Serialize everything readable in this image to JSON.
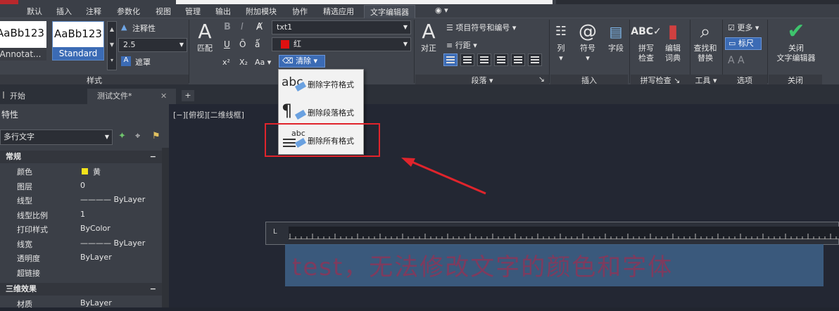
{
  "ribbon_tabs": [
    "默认",
    "插入",
    "注释",
    "参数化",
    "视图",
    "管理",
    "输出",
    "附加模块",
    "协作",
    "精选应用",
    "文字编辑器"
  ],
  "style_panel": {
    "samples": [
      {
        "preview": "AaBb123",
        "name": "Annotat..."
      },
      {
        "preview": "AaBb123",
        "name": "Standard"
      }
    ],
    "annotative": "注释性",
    "height": "2.5",
    "mask": "遮罩",
    "match": "匹配",
    "title": "样式"
  },
  "format_panel": {
    "font": "txt1",
    "color": "红",
    "color_hex": "#e01010",
    "clear": "清除",
    "bold": "B",
    "italic": "I",
    "underline": "U",
    "overline": "Ō",
    "sup": "x²",
    "sub": "X₂",
    "case": "Aa"
  },
  "paragraph_panel": {
    "align": "对正",
    "bullets": "项目符号和编号",
    "spacing": "行距",
    "title": "段落"
  },
  "insert_panel": {
    "columns": "列",
    "symbol": "符号",
    "field": "字段",
    "title": "插入"
  },
  "spell_panel": {
    "check": "拼写\n检查",
    "dict": "编辑\n词典",
    "title": "拼写检查"
  },
  "tools_panel": {
    "find": "查找和\n替换",
    "title": "工具"
  },
  "options_panel": {
    "more": "更多",
    "ruler": "标尺",
    "title": "选项"
  },
  "close_panel": {
    "close": "关闭\n文字编辑器",
    "title": "关闭"
  },
  "doc_tabs": [
    "开始",
    "测试文件*"
  ],
  "properties": {
    "title": "特性",
    "selection": "多行文字",
    "sections": {
      "general": "常规",
      "3d": "三维效果"
    },
    "rows": [
      {
        "k": "颜色",
        "v": "黄"
      },
      {
        "k": "图层",
        "v": "0"
      },
      {
        "k": "线型",
        "v": "———— ByLayer"
      },
      {
        "k": "线型比例",
        "v": "1"
      },
      {
        "k": "打印样式",
        "v": "ByColor"
      },
      {
        "k": "线宽",
        "v": "———— ByLayer"
      },
      {
        "k": "透明度",
        "v": "ByLayer"
      },
      {
        "k": "超链接",
        "v": ""
      }
    ],
    "material": {
      "k": "材质",
      "v": "ByLayer"
    }
  },
  "view_label": "[−][俯视][二维线框]",
  "edit_text": "test，无法修改文字的颜色和字体",
  "clear_menu": [
    {
      "icon": "abc",
      "label": "删除字符格式"
    },
    {
      "icon": "¶",
      "label": "删除段落格式"
    },
    {
      "icon": "abc",
      "label": "删除所有格式"
    }
  ]
}
